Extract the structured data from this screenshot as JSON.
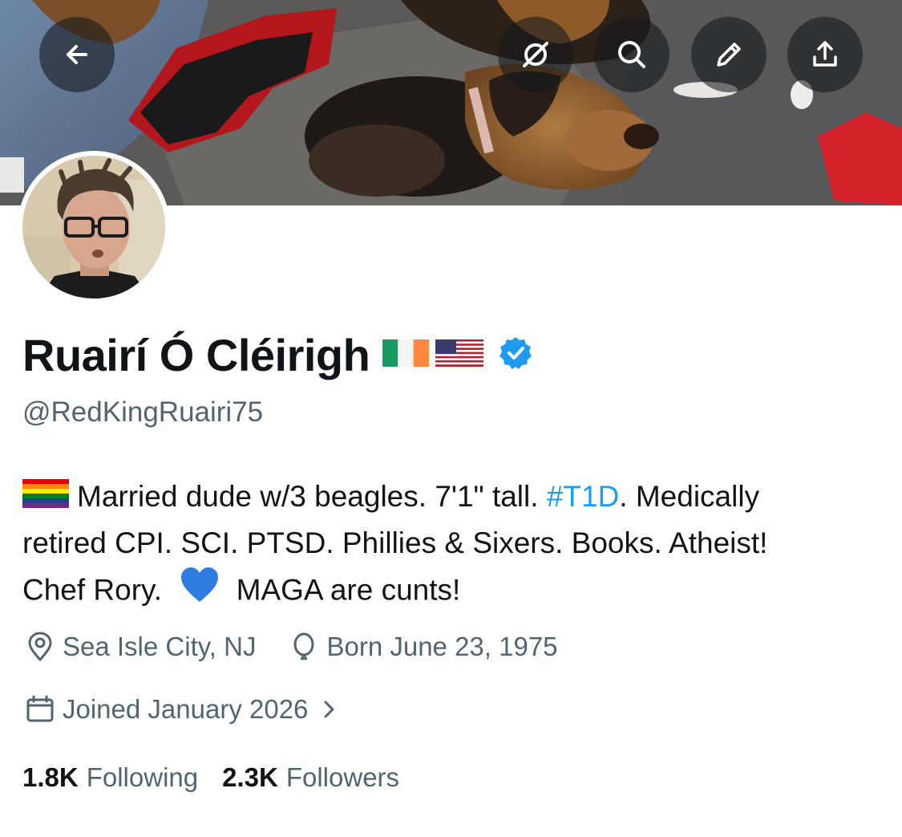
{
  "header": {
    "back_icon": "arrow-left-icon",
    "grok_icon": "grok-icon",
    "search_icon": "search-icon",
    "edit_icon": "pencil-icon",
    "share_icon": "share-icon"
  },
  "profile": {
    "display_name": "Ruairí Ó Cléirigh",
    "flags": [
      "flag-ireland",
      "flag-united-states"
    ],
    "verified": true,
    "handle": "@RedKingRuairi75",
    "bio": {
      "line1_pre": "Married dude w/3 beagles. 7'1\" tall. ",
      "hashtag": "#T1D",
      "line1_post": ". Medically",
      "line2": "retired CPI. SCI. PTSD. Phillies & Sixers. Books. Atheist!",
      "line3_pre": "Chef Rory.",
      "line3_post": "MAGA are cunts!"
    },
    "location": "Sea Isle City, NJ",
    "birthday": "Born June 23, 1975",
    "joined": "Joined January 2026",
    "following_count": "1.8K",
    "following_label": "Following",
    "followers_count": "2.3K",
    "followers_label": "Followers"
  },
  "colors": {
    "accent": "#1d9bf0",
    "text_primary": "#0f1419",
    "text_secondary": "#536471",
    "heart_blue": "#2f7de1"
  }
}
